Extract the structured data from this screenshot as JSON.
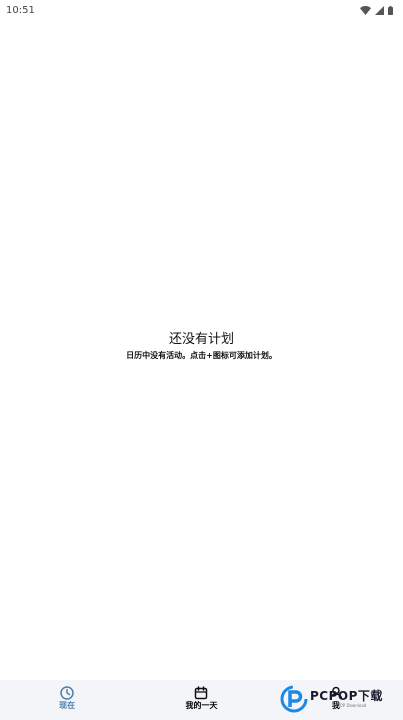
{
  "status_bar": {
    "time": "10:51"
  },
  "empty_state": {
    "title": "还没有计划",
    "subtitle": "日历中没有活动。点击+图标可添加计划。"
  },
  "bottom_nav": {
    "items": [
      {
        "label": "现在",
        "icon": "clock-icon",
        "active": true
      },
      {
        "label": "我的一天",
        "icon": "calendar-icon",
        "active": false
      },
      {
        "label": "我",
        "icon": "person-icon",
        "active": false
      }
    ]
  },
  "watermark": {
    "text": "PCPOP下载",
    "subtext": "PCPOP Download"
  },
  "colors": {
    "accent": "#4a7fb0",
    "nav_background": "#f4f5f8",
    "watermark_blue": "#1e88e5"
  }
}
